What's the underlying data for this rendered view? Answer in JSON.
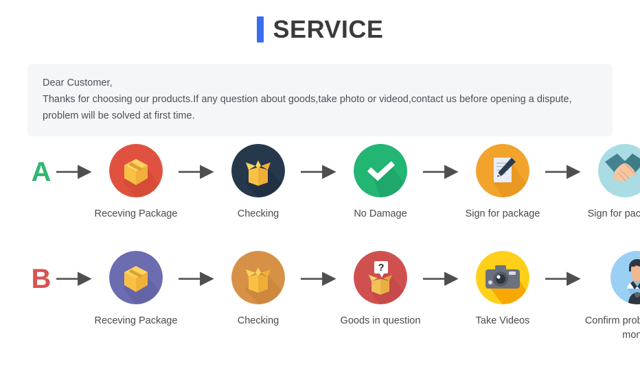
{
  "header": {
    "title": "SERVICE",
    "accent_color": "#3a6ef0"
  },
  "notice": {
    "line1": "Dear Customer,",
    "line2": "Thanks for choosing our products.If any question about goods,take photo or videod,contact us before opening a dispute,",
    "line3": "problem will be solved at first time.",
    "background_color": "#f5f6f8"
  },
  "flows": [
    {
      "badge": "A",
      "badge_color": "#2eb872",
      "steps": [
        {
          "label": "Receving Package",
          "icon": "package-box-icon",
          "circle_color": "#e0523f"
        },
        {
          "label": "Checking",
          "icon": "open-box-icon",
          "circle_color": "#26384c"
        },
        {
          "label": "No Damage",
          "icon": "check-mark-icon",
          "circle_color": "#22b573"
        },
        {
          "label": "Sign for package",
          "icon": "document-pen-icon",
          "circle_color": "#f2a32c"
        },
        {
          "label": "Sign for package",
          "icon": "handshake-icon",
          "circle_color": "#a9dce3"
        }
      ]
    },
    {
      "badge": "B",
      "badge_color": "#d9534f",
      "steps": [
        {
          "label": "Receving Package",
          "icon": "package-box-icon",
          "circle_color": "#6c6cb0"
        },
        {
          "label": "Checking",
          "icon": "open-box-icon",
          "circle_color": "#d79146"
        },
        {
          "label": "Goods in question",
          "icon": "question-box-icon",
          "circle_color": "#d0504f"
        },
        {
          "label": "Take Videos",
          "icon": "camera-icon",
          "circle_color": "#ffd01a"
        },
        {
          "label": "Confirm problem,refund money",
          "icon": "person-avatar-icon",
          "circle_color": "#9bd0f5"
        }
      ]
    }
  ]
}
